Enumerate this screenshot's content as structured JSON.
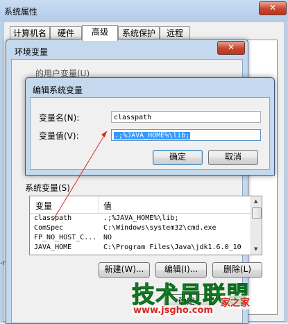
{
  "system_properties": {
    "title": "系统属性",
    "close_label": "✕",
    "tabs": [
      "计算机名",
      "硬件",
      "高级",
      "系统保护",
      "远程"
    ],
    "active_tab": "高级",
    "left_edge_fragment": "-rc"
  },
  "env_window": {
    "title": "环境变量",
    "close_label": "✕",
    "user_vars_label": "的用户变量(U)",
    "sys_vars_label": "系统变量(S)",
    "columns": [
      "变量",
      "值"
    ],
    "rows": [
      {
        "name": "classpath",
        "value": ".;%JAVA_HOME%\\lib;"
      },
      {
        "name": "ComSpec",
        "value": "C:\\Windows\\system32\\cmd.exe"
      },
      {
        "name": "FP_NO_HOST_C...",
        "value": "NO"
      },
      {
        "name": "JAVA_HOME",
        "value": "C:\\Program Files\\Java\\jdk1.6.0_10"
      }
    ],
    "buttons": {
      "new": "新建(W)...",
      "edit": "编辑(I)...",
      "delete": "删除(L)",
      "ok": "确定"
    }
  },
  "edit_dialog": {
    "title": "编辑系统变量",
    "name_label": "变量名(N):",
    "value_label": "变量值(V):",
    "name_value": "classpath",
    "value_value": ".;%JAVA_HOME%\\lib;",
    "ok": "确定",
    "cancel": "取消"
  },
  "watermark": {
    "logo": "技术员联盟",
    "url": "www.jsgho.com",
    "red_fragment": "家之家"
  },
  "colors": {
    "selection": "#3399ff",
    "title_bar": "#c4d8ee",
    "annotation": "#d5281f",
    "watermark_green": "#27b23a"
  }
}
